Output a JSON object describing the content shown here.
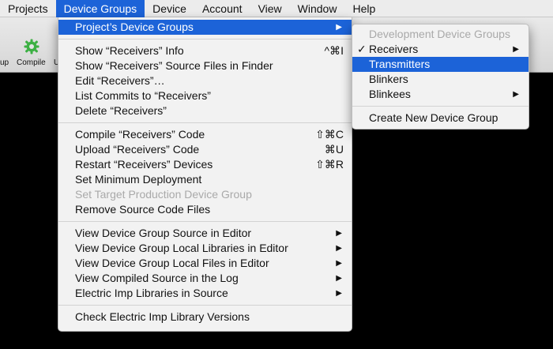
{
  "menubar": {
    "items": [
      "Projects",
      "Device Groups",
      "Device",
      "Account",
      "View",
      "Window",
      "Help"
    ],
    "active": "Device Groups"
  },
  "toolbar": {
    "left_partial_label": "up",
    "compile_label": "Compile",
    "next_partial_label": "U"
  },
  "main_menu": {
    "projects_device_groups": "Project’s Device Groups",
    "show_info": "Show “Receivers” Info",
    "show_info_shortcut": "^⌘I",
    "show_source_files": "Show “Receivers” Source Files in Finder",
    "edit": "Edit “Receivers”…",
    "list_commits": "List Commits to “Receivers”",
    "delete": "Delete “Receivers”",
    "compile_code": "Compile “Receivers” Code",
    "compile_shortcut": "⇧⌘C",
    "upload_code": "Upload “Receivers” Code",
    "upload_shortcut": "⌘U",
    "restart_devices": "Restart “Receivers” Devices",
    "restart_shortcut": "⇧⌘R",
    "set_min_deployment": "Set Minimum Deployment",
    "set_target_production": "Set Target Production Device Group",
    "remove_source": "Remove Source Code Files",
    "view_source_editor": "View Device Group Source in Editor",
    "view_local_libraries": "View Device Group Local Libraries in Editor",
    "view_local_files": "View Device Group Local Files in Editor",
    "view_compiled_source": "View Compiled Source in the Log",
    "electric_imp_libraries": "Electric Imp Libraries in Source",
    "check_library_versions": "Check Electric Imp Library Versions"
  },
  "sub_menu": {
    "header": "Development Device Groups",
    "receivers": "Receivers",
    "transmitters": "Transmitters",
    "blinkers": "Blinkers",
    "blinkees": "Blinkees",
    "create_new": "Create New Device Group",
    "check_mark": "✓",
    "selected": "Receivers",
    "highlighted": "Transmitters"
  },
  "colors": {
    "highlight": "#1c63d8",
    "menu_background": "#f2f2f2",
    "disabled_text": "#a9a9a9",
    "compile_icon": "#3cb043"
  }
}
